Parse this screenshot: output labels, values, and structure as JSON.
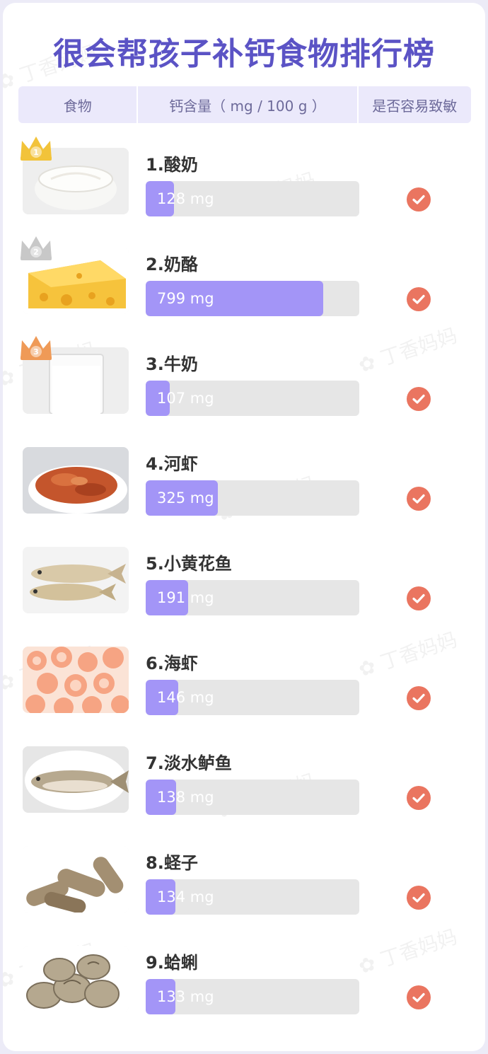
{
  "title": "很会帮孩子补钙食物排行榜",
  "watermark": "丁香妈妈",
  "header": {
    "food": "食物",
    "calcium": "钙含量（ mg / 100 g ）",
    "allergy": "是否容易致敏"
  },
  "colors": {
    "title": "#5b53c5",
    "bar_fill": "#a395f7",
    "bar_track": "#e6e6e6",
    "check": "#ea7560",
    "crown_gold": "#f2c33a",
    "crown_silver": "#c8c8c8",
    "crown_bronze": "#ef9a57"
  },
  "chart_data": {
    "type": "bar",
    "title": "很会帮孩子补钙食物排行榜",
    "xlabel": "食物",
    "ylabel": "钙含量（ mg / 100 g ）",
    "unit": "mg",
    "categories": [
      "酸奶",
      "奶酪",
      "牛奶",
      "河虾",
      "小黄花鱼",
      "海虾",
      "淡水鲈鱼",
      "蛏子",
      "蛤蜊"
    ],
    "values": [
      128,
      799,
      107,
      325,
      191,
      146,
      138,
      134,
      133
    ],
    "ranks": [
      "1.",
      "2.",
      "3.",
      "4.",
      "5.",
      "6.",
      "7.",
      "8.",
      "9."
    ],
    "easy_allergy": [
      true,
      true,
      true,
      true,
      true,
      true,
      true,
      true,
      true
    ],
    "crowns": [
      "1",
      "2",
      "3"
    ],
    "icons": [
      "yogurt-icon",
      "cheese-icon",
      "milk-icon",
      "river-shrimp-icon",
      "yellow-croaker-icon",
      "sea-shrimp-icon",
      "perch-icon",
      "razor-clam-icon",
      "clam-icon"
    ],
    "ylim": [
      0,
      960
    ],
    "grid": false,
    "legend": "none"
  }
}
